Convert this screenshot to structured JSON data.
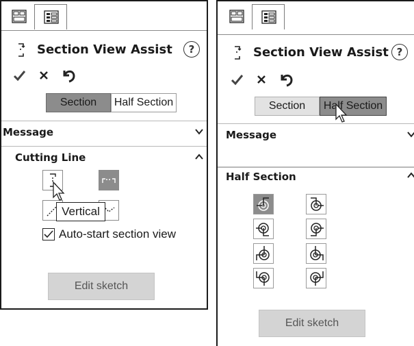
{
  "left_panel": {
    "title": "Section View Assist",
    "help_label": "?",
    "segment": {
      "section_label": "Section",
      "half_section_label": "Half Section",
      "active": "Section"
    },
    "message_header": "Message",
    "cutting_line_header": "Cutting Line",
    "tooltip": "Vertical",
    "auto_start_label": "Auto-start section view",
    "auto_start_checked": true,
    "edit_sketch_label": "Edit sketch"
  },
  "right_panel": {
    "title": "Section View Assist",
    "help_label": "?",
    "segment": {
      "section_label": "Section",
      "half_section_label": "Half Section",
      "active": "Half Section"
    },
    "message_header": "Message",
    "half_section_header": "Half Section",
    "edit_sketch_label": "Edit sketch"
  },
  "colors": {
    "pressed": "#8c8c8c",
    "button_gray": "#d4d4d4",
    "border": "#1a1a1a"
  }
}
